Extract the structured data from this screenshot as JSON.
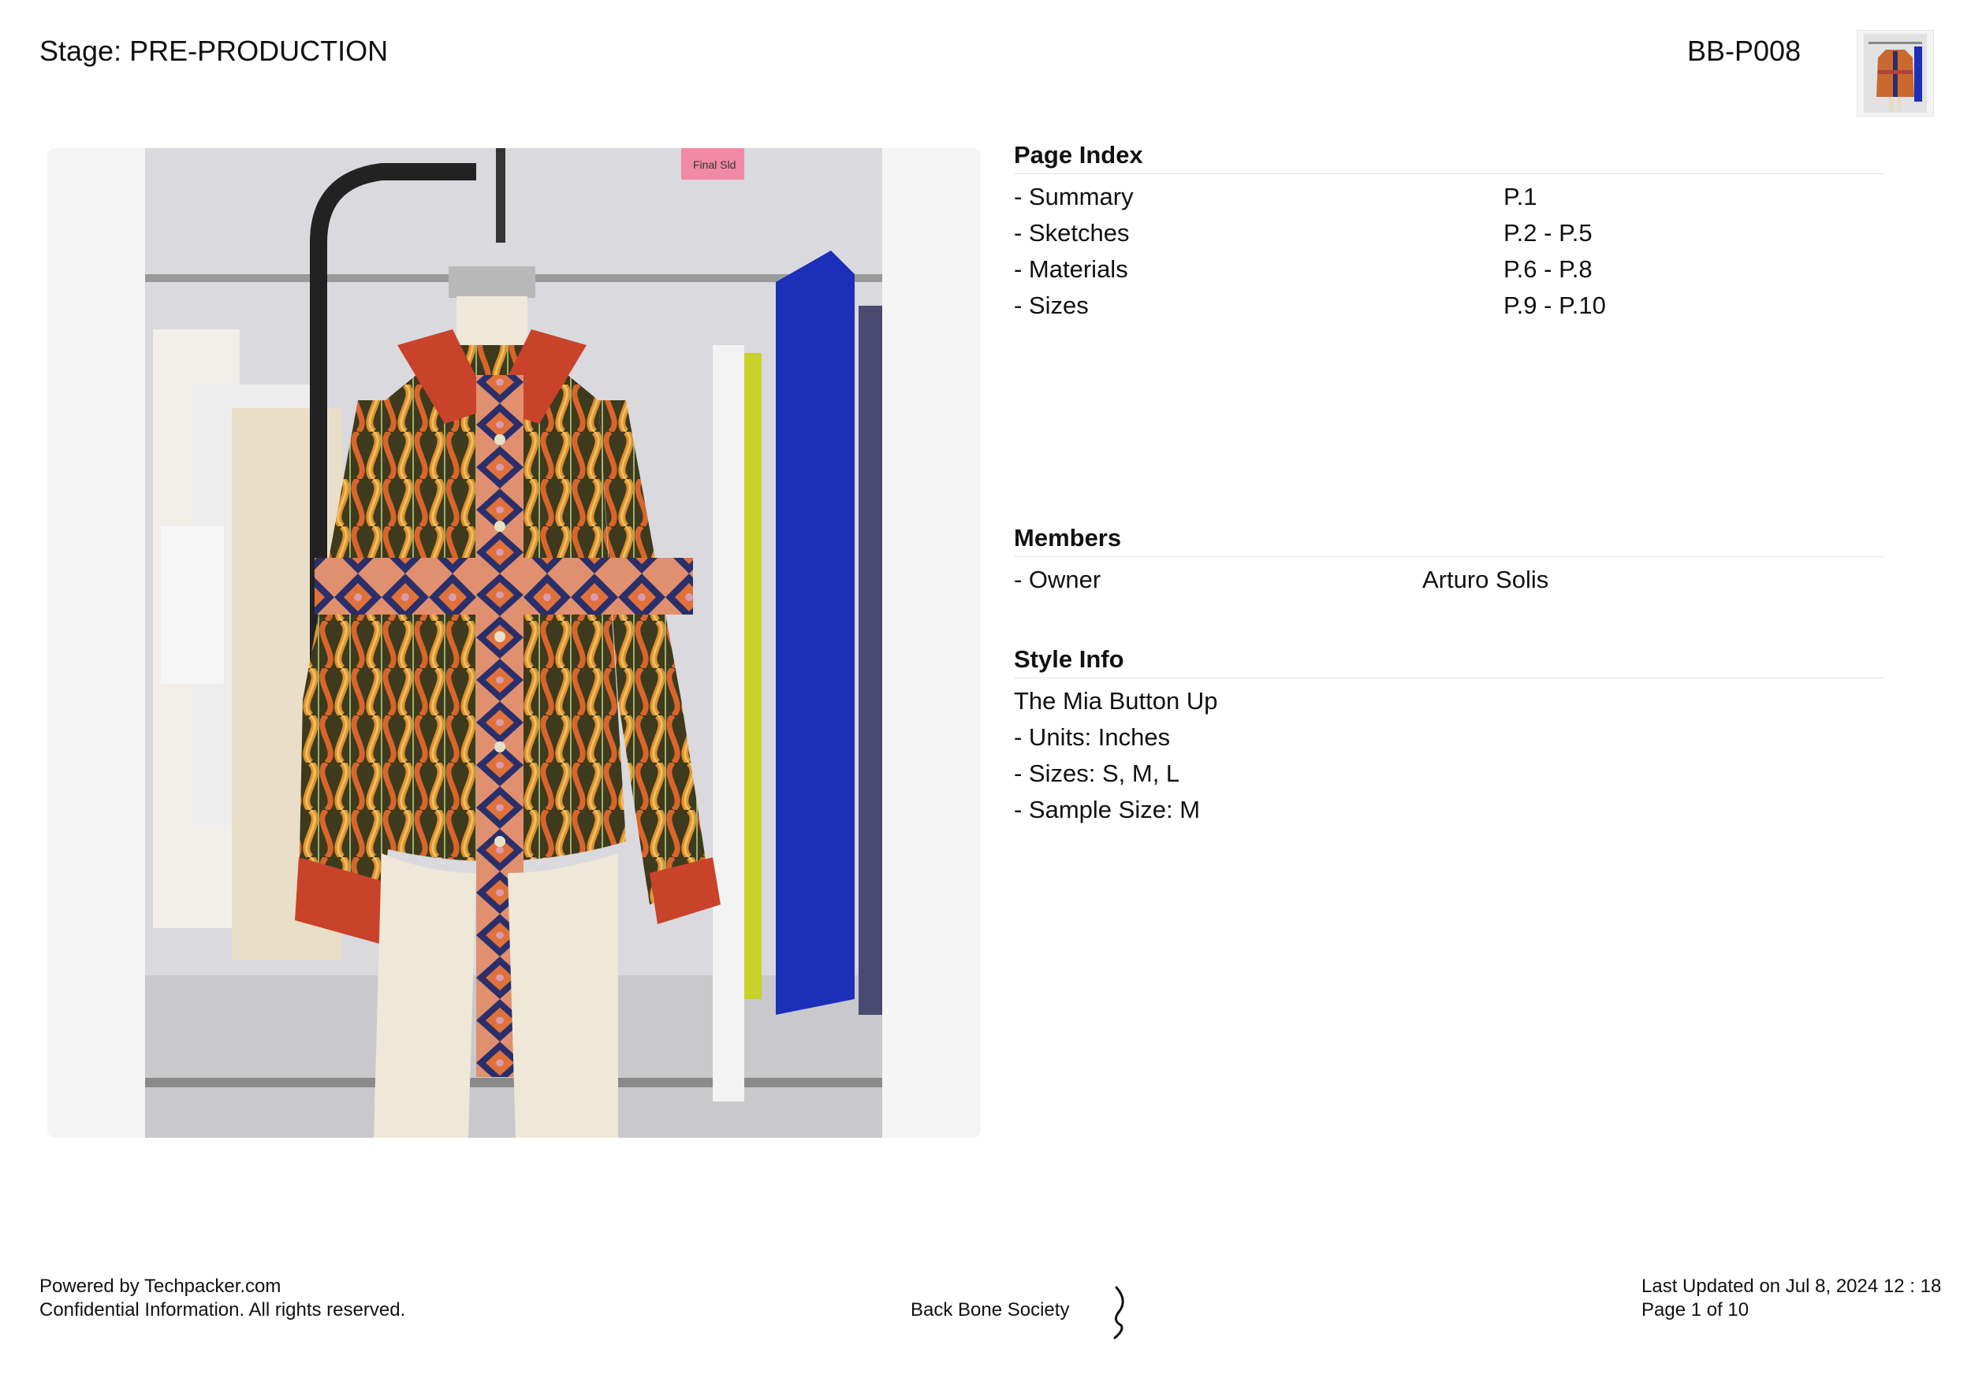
{
  "header": {
    "stage": "Stage: PRE-PRODUCTION",
    "style_code": "BB-P008"
  },
  "photo": {
    "description_icon": "garment-photo",
    "sticky_note": "Final Sld"
  },
  "page_index": {
    "title": "Page Index",
    "items": [
      {
        "label": "- Summary",
        "pages": "P.1"
      },
      {
        "label": "- Sketches",
        "pages": "P.2 - P.5"
      },
      {
        "label": "- Materials",
        "pages": "P.6 - P.8"
      },
      {
        "label": "- Sizes",
        "pages": "P.9 - P.10"
      }
    ]
  },
  "members": {
    "title": "Members",
    "items": [
      {
        "role": "- Owner",
        "name": "Arturo Solis"
      }
    ]
  },
  "style_info": {
    "title": "Style Info",
    "name": "The Mia Button Up",
    "units": "- Units: Inches",
    "sizes": "- Sizes: S, M, L",
    "sample_size": "- Sample Size: M"
  },
  "footer": {
    "powered_by": "Powered by Techpacker.com",
    "confidential": "Confidential Information. All rights reserved.",
    "company": "Back Bone Society",
    "logo_icon": "back-bone-society-logo",
    "last_updated": "Last Updated on Jul 8, 2024 12 : 18",
    "page_number": "Page 1 of 10"
  },
  "colors": {
    "text": "#111111",
    "divider": "#e3e3e3",
    "photo_bg": "#f5f5f5",
    "shirt_orange": "#e07a2e",
    "shirt_red": "#c8432a",
    "shirt_navy": "#2a2f6b",
    "shirt_olive": "#4a4a26",
    "blue_garment": "#1c2fb8"
  }
}
